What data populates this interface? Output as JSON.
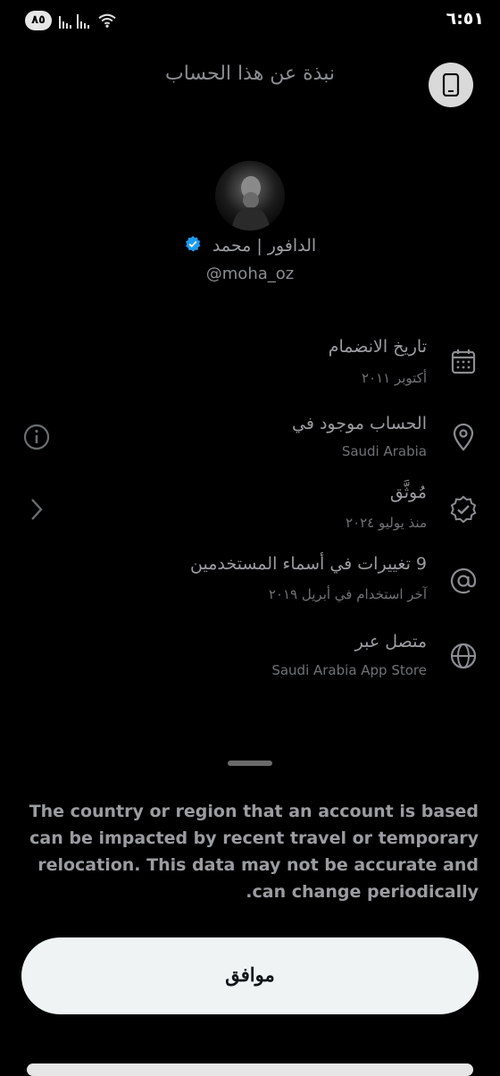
{
  "status_bar": {
    "time": "٦:٥١",
    "battery": "٨٥"
  },
  "header": {
    "title": "نبذة عن هذا الحساب"
  },
  "profile": {
    "display_name": "الدافور | محمد",
    "handle": "@moha_oz",
    "verified_color": "#1d9bf0"
  },
  "rows": [
    {
      "icon": "calendar-icon",
      "title": "تاريخ الانضمام",
      "subtitle": "أكتوبر ٢٠١١"
    },
    {
      "icon": "location-pin-icon",
      "title": "الحساب موجود في",
      "subtitle": "Saudi Arabia"
    },
    {
      "icon": "verified-badge-icon",
      "title": "مُوثَّق",
      "subtitle": "منذ يوليو ٢٠٢٤"
    },
    {
      "icon": "at-sign-icon",
      "title": "9 تغييرات في أسماء المستخدمين",
      "subtitle": "آخر استخدام في أبريل ٢٠١٩"
    },
    {
      "icon": "globe-icon",
      "title": "متصل عبر",
      "subtitle": "Saudi Arabia App Store"
    }
  ],
  "notice": "The country or region that an account is based can be impacted by recent travel or temporary relocation. This data may not be accurate and can change periodically.",
  "ok_button": "موافق"
}
